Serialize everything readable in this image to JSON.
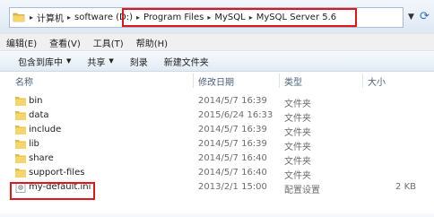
{
  "address": {
    "crumbs": [
      "计算机",
      "software (D:)",
      "Program Files",
      "MySQL",
      "MySQL Server 5.6"
    ],
    "dropdown_icon": "chevron-down-icon",
    "refresh_icon": "refresh-icon"
  },
  "menu": [
    "编辑(E)",
    "查看(V)",
    "工具(T)",
    "帮助(H)"
  ],
  "toolbar": {
    "include_label": "包含到库中",
    "share_label": "共享",
    "burn_label": "刻录",
    "new_folder_label": "新建文件夹"
  },
  "columns": {
    "name": "名称",
    "modified": "修改日期",
    "type": "类型",
    "size": "大小"
  },
  "files": [
    {
      "name": "bin",
      "modified": "2014/5/7 16:39",
      "type": "文件夹",
      "size": "",
      "icon": "folder-icon"
    },
    {
      "name": "data",
      "modified": "2015/6/24 16:33",
      "type": "文件夹",
      "size": "",
      "icon": "folder-icon"
    },
    {
      "name": "include",
      "modified": "2014/5/7 16:39",
      "type": "文件夹",
      "size": "",
      "icon": "folder-icon"
    },
    {
      "name": "lib",
      "modified": "2014/5/7 16:39",
      "type": "文件夹",
      "size": "",
      "icon": "folder-icon"
    },
    {
      "name": "share",
      "modified": "2014/5/7 16:40",
      "type": "文件夹",
      "size": "",
      "icon": "folder-icon"
    },
    {
      "name": "support-files",
      "modified": "2014/5/7 16:40",
      "type": "文件夹",
      "size": "",
      "icon": "folder-icon"
    },
    {
      "name": "my-default.ini",
      "modified": "2013/2/1 15:00",
      "type": "配置设置",
      "size": "2 KB",
      "icon": "ini-file-icon"
    }
  ],
  "colors": {
    "highlight": "#e0161b",
    "folder": "#f0c24a"
  }
}
